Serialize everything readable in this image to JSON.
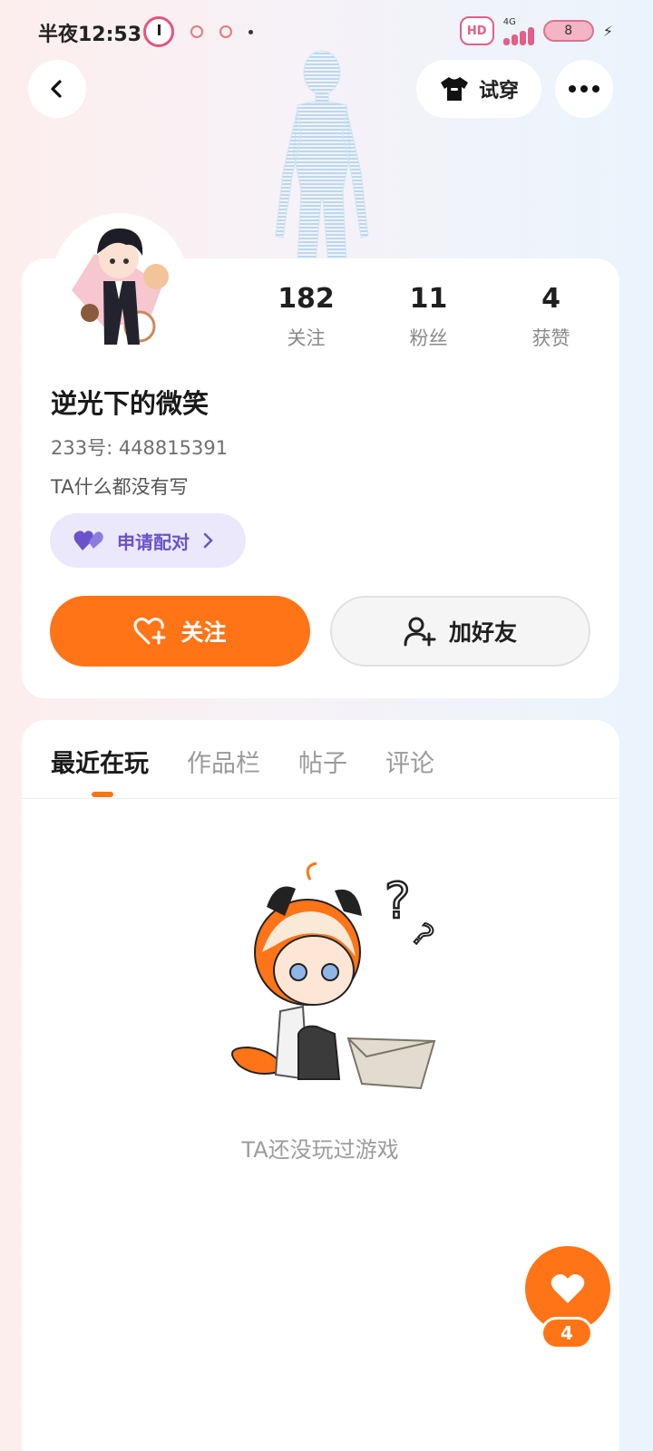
{
  "status_bar": {
    "time": "半夜12:53",
    "network": "4G",
    "battery": "8",
    "hd_label": "HD"
  },
  "nav": {
    "try_on_label": "试穿",
    "icons": [
      "back-arrow-icon",
      "tshirt-icon",
      "more-dots-icon"
    ]
  },
  "profile": {
    "stats": [
      {
        "value": "182",
        "label": "关注"
      },
      {
        "value": "11",
        "label": "粉丝"
      },
      {
        "value": "4",
        "label": "获赞"
      }
    ],
    "username": "逆光下的微笑",
    "uid": "233号: 448815391",
    "bio": "TA什么都没有写",
    "pair_label": "申请配对",
    "follow_label": "关注",
    "add_friend_label": "加好友"
  },
  "tabs": [
    {
      "label": "最近在玩",
      "active": true
    },
    {
      "label": "作品栏",
      "active": false
    },
    {
      "label": "帖子",
      "active": false
    },
    {
      "label": "评论",
      "active": false
    }
  ],
  "empty_state": {
    "text": "TA还没玩过游戏"
  },
  "like": {
    "count": "4"
  },
  "colors": {
    "accent": "#ff7416",
    "pair_bg": "#ebe8fb",
    "pair_text": "#6b52c9"
  }
}
